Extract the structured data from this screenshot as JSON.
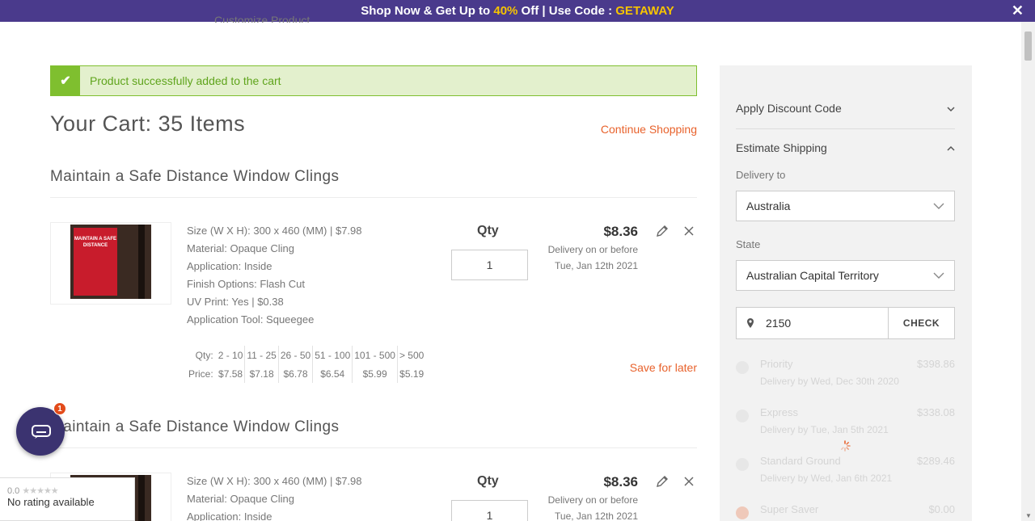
{
  "promo": {
    "prefix": "Shop Now & Get Up to ",
    "percent": "40%",
    "middle": " Off | Use Code : ",
    "code": "GETAWAY",
    "close": "✕"
  },
  "ghost_text": "Customize Product",
  "alert": {
    "message": "Product successfully added to the cart"
  },
  "cart": {
    "title": "Your Cart: 35 Items",
    "continue_label": "Continue Shopping",
    "items": [
      {
        "title": "Maintain a Safe Distance Window Clings",
        "specs": [
          "Size (W X H): 300 x 460 (MM) | $7.98",
          "Material: Opaque Cling",
          "Application: Inside",
          "Finish Options: Flash Cut",
          "UV Print: Yes | $0.38",
          "Application Tool: Squeegee"
        ],
        "qty_label": "Qty",
        "qty_value": "1",
        "price": "$8.36",
        "delivery_line1": "Delivery on or before",
        "delivery_line2": "Tue, Jan 12th 2021",
        "image_text": "MAINTAIN A SAFE DISTANCE"
      },
      {
        "title": "Maintain a Safe Distance Window Clings",
        "specs": [
          "Size (W X H): 300 x 460 (MM) | $7.98",
          "Material: Opaque Cling",
          "Application: Inside"
        ],
        "qty_label": "Qty",
        "qty_value": "1",
        "price": "$8.36",
        "delivery_line1": "Delivery on or before",
        "delivery_line2": "Tue, Jan 12th 2021"
      }
    ],
    "pricing": {
      "qty_label": "Qty:",
      "price_label": "Price:",
      "ranges": [
        "2 - 10",
        "11 - 25",
        "26 - 50",
        "51 - 100",
        "101 - 500",
        "> 500"
      ],
      "prices": [
        "$7.58",
        "$7.18",
        "$6.78",
        "$6.54",
        "$5.99",
        "$5.19"
      ]
    },
    "save_later": "Save for later"
  },
  "sidebar": {
    "discount_label": "Apply Discount Code",
    "shipping_label": "Estimate Shipping",
    "delivery_to_label": "Delivery to",
    "country": "Australia",
    "state_label": "State",
    "state": "Australian Capital Territory",
    "zip": "2150",
    "check_label": "CHECK",
    "options": [
      {
        "name": "Priority",
        "cost": "$398.86",
        "sub": "Delivery by Wed, Dec 30th 2020"
      },
      {
        "name": "Express",
        "cost": "$338.08",
        "sub": "Delivery by Tue, Jan 5th 2021"
      },
      {
        "name": "Standard Ground",
        "cost": "$289.46",
        "sub": "Delivery by Wed, Jan 6th 2021"
      },
      {
        "name": "Super Saver",
        "cost": "$0.00",
        "sub": ""
      }
    ]
  },
  "chat": {
    "badge": "1"
  },
  "rating": {
    "score": "0.0",
    "stars": "★★★★★",
    "text": "No rating available"
  },
  "colors": {
    "accent": "#e8622c",
    "promo_bg": "#4a3a8c",
    "success": "#7fbf2f"
  }
}
